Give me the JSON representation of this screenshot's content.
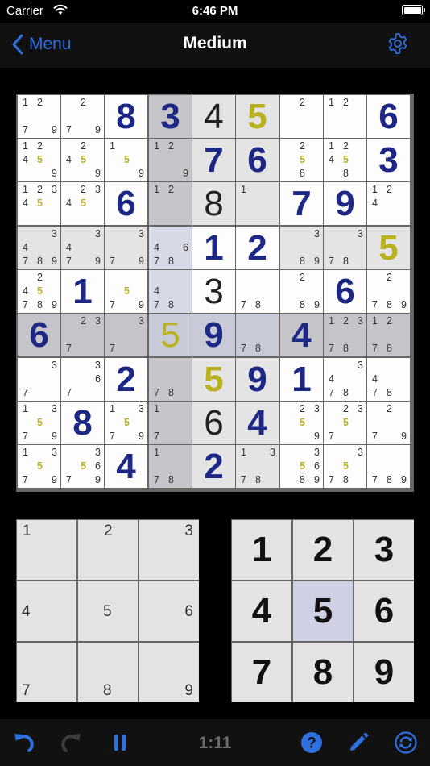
{
  "status": {
    "carrier": "Carrier",
    "time": "6:46 PM"
  },
  "nav": {
    "back_label": "Menu",
    "title": "Medium"
  },
  "colors": {
    "accent": "#2f6fe0",
    "given_digit": "#1d2784",
    "highlight_digit": "#b9b120"
  },
  "board": {
    "values": [
      [
        "",
        "",
        "8",
        "3",
        "4",
        "5",
        "",
        "",
        "6"
      ],
      [
        "",
        "",
        "",
        "",
        "7",
        "6",
        "",
        "",
        "3"
      ],
      [
        "",
        "",
        "6",
        "",
        "8",
        "",
        "7",
        "9",
        ""
      ],
      [
        "",
        "",
        "",
        "",
        "1",
        "2",
        "",
        "",
        "5"
      ],
      [
        "",
        "1",
        "",
        "",
        "3",
        "",
        "",
        "6",
        ""
      ],
      [
        "6",
        "",
        "",
        "5",
        "9",
        "",
        "4",
        "",
        ""
      ],
      [
        "",
        "",
        "2",
        "",
        "5",
        "9",
        "1",
        "",
        ""
      ],
      [
        "",
        "8",
        "",
        "",
        "6",
        "4",
        "",
        "",
        ""
      ],
      [
        "",
        "",
        "4",
        "",
        "2",
        "",
        "",
        "",
        ""
      ]
    ],
    "value_style": [
      [
        "",
        "",
        "given",
        "given",
        "user",
        "yel",
        "",
        "",
        "given"
      ],
      [
        "",
        "",
        "",
        "",
        "given",
        "given",
        "",
        "",
        "given"
      ],
      [
        "",
        "",
        "given",
        "",
        "user",
        "",
        "given",
        "given",
        ""
      ],
      [
        "",
        "",
        "",
        "",
        "given",
        "given",
        "",
        "",
        "yel"
      ],
      [
        "",
        "given",
        "",
        "",
        "user",
        "",
        "",
        "given",
        ""
      ],
      [
        "given",
        "",
        "",
        "yelthin",
        "given",
        "",
        "given",
        "",
        ""
      ],
      [
        "",
        "",
        "given",
        "",
        "yel",
        "given",
        "given",
        "",
        ""
      ],
      [
        "",
        "given",
        "",
        "",
        "user",
        "given",
        "",
        "",
        ""
      ],
      [
        "",
        "",
        "given",
        "",
        "given",
        "",
        "",
        "",
        ""
      ]
    ],
    "shade": [
      [
        "w",
        "w",
        "w",
        "s",
        "l",
        "l",
        "w",
        "w",
        "w"
      ],
      [
        "w",
        "w",
        "w",
        "s",
        "l",
        "l",
        "w",
        "w",
        "w"
      ],
      [
        "w",
        "w",
        "w",
        "s",
        "l",
        "l",
        "w",
        "w",
        "w"
      ],
      [
        "l",
        "l",
        "l",
        "p",
        "w",
        "w",
        "l",
        "l",
        "l"
      ],
      [
        "w",
        "w",
        "w",
        "p",
        "w",
        "w",
        "w",
        "w",
        "w"
      ],
      [
        "s",
        "s",
        "s",
        "m",
        "m",
        "m",
        "s",
        "s",
        "s"
      ],
      [
        "w",
        "w",
        "w",
        "s",
        "l",
        "l",
        "w",
        "w",
        "w"
      ],
      [
        "w",
        "w",
        "w",
        "s",
        "l",
        "l",
        "w",
        "w",
        "w"
      ],
      [
        "w",
        "w",
        "w",
        "s",
        "l",
        "l",
        "w",
        "w",
        "w"
      ]
    ],
    "notes": [
      [
        "1 2 7 9",
        "2 7 9",
        "",
        "",
        "",
        "",
        "2",
        "1 2",
        ""
      ],
      [
        "1 2 4 5 9",
        "2 4 5 9",
        "1 5 9",
        "1 2 9",
        "",
        "",
        "2 5 8",
        "1 2 4 5 8",
        ""
      ],
      [
        "1 2 3 4 5",
        "2 3 4 5",
        "",
        "1 2",
        "",
        "1",
        "",
        "",
        "1 2 4"
      ],
      [
        "3 4 7 8 9",
        "3 4 7 9",
        "3 7 9",
        "4 6 7 8",
        "",
        "",
        "3 8 9",
        "3 7 8",
        ""
      ],
      [
        "2 4 5 7 8 9",
        "",
        "5 7 9",
        "4 7 8",
        "",
        "7 8",
        "2 8 9",
        "",
        "2 7 8 9"
      ],
      [
        "",
        "2 3 7",
        "3 7",
        "",
        "",
        "7 8",
        "",
        "1 2 3 7 8",
        "1 2 7 8"
      ],
      [
        "3 7",
        "3 6 7",
        "",
        "7 8",
        "",
        "",
        "",
        "3 4 7 8",
        "4 7 8"
      ],
      [
        "1 3 5 7 9",
        "",
        "1 3 5 7 9",
        "1 7",
        "",
        "",
        "2 3 5 9",
        "2 3 5 7",
        "2 7 9"
      ],
      [
        "1 3 5 7 9",
        "3 5 6 7 9",
        "",
        "1 7 8",
        "",
        "1 3 7 8",
        "3 5 6 8 9",
        "3 5 7 8",
        "7 8 9"
      ]
    ],
    "highlight_digit": "5"
  },
  "notes_pad": {
    "keys": [
      "1",
      "2",
      "3",
      "4",
      "5",
      "6",
      "7",
      "8",
      "9"
    ]
  },
  "digit_pad": {
    "keys": [
      "1",
      "2",
      "3",
      "4",
      "5",
      "6",
      "7",
      "8",
      "9"
    ],
    "selected": "5"
  },
  "toolbar": {
    "timer": "1:11"
  }
}
